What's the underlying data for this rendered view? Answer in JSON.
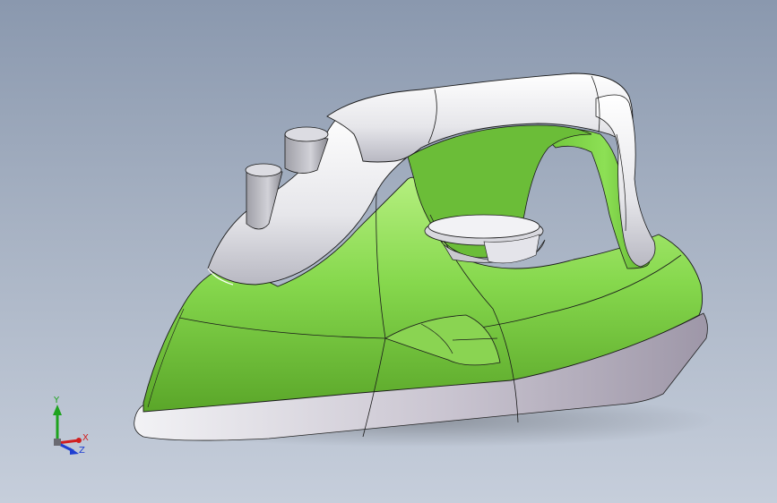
{
  "viewport": {
    "background_top": "#8a98ae",
    "background_bottom": "#c6cedb"
  },
  "model": {
    "body_color": "#7ed24a",
    "shell_color": "#e9e9ee",
    "edge_color": "#1a1a1a"
  },
  "triad": {
    "x_label": "X",
    "y_label": "Y",
    "z_label": "Z",
    "x_color": "#d11f1f",
    "y_color": "#1ea31e",
    "z_color": "#1f3fd1"
  }
}
